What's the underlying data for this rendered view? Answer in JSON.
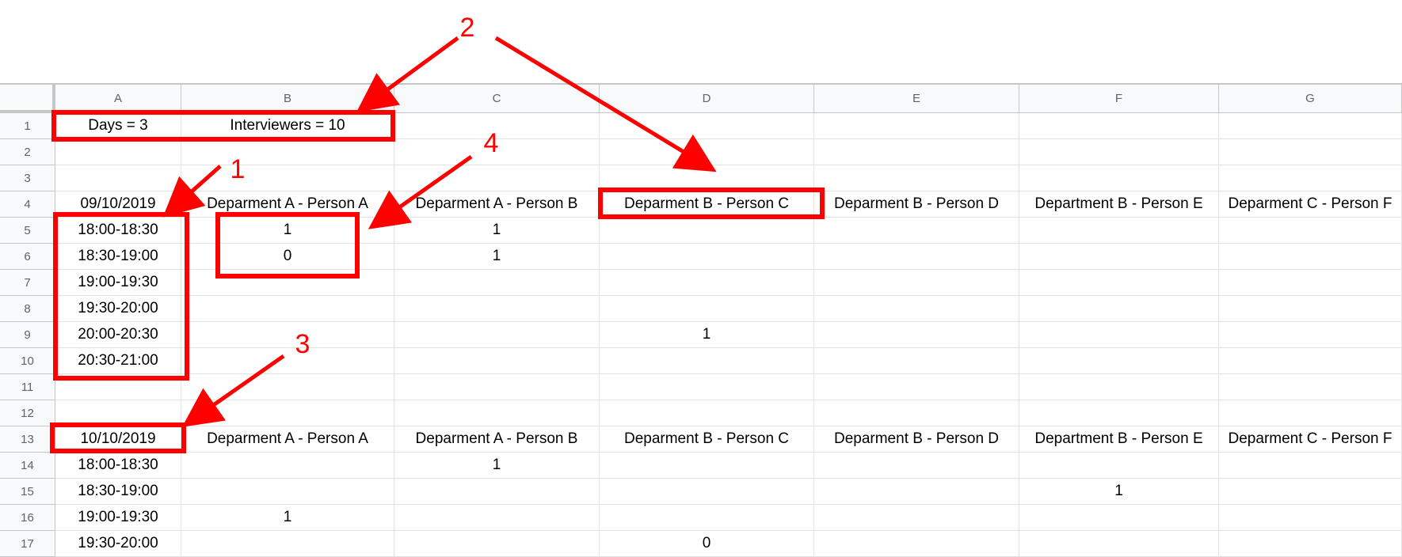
{
  "columns": [
    "A",
    "B",
    "C",
    "D",
    "E",
    "F",
    "G"
  ],
  "rows": [
    {
      "num": "1",
      "cells": [
        "Days = 3",
        "Interviewers = 10",
        "",
        "",
        "",
        "",
        ""
      ]
    },
    {
      "num": "2",
      "cells": [
        "",
        "",
        "",
        "",
        "",
        "",
        ""
      ]
    },
    {
      "num": "3",
      "cells": [
        "",
        "",
        "",
        "",
        "",
        "",
        ""
      ]
    },
    {
      "num": "4",
      "cells": [
        "09/10/2019",
        "Deparment A - Person A",
        "Deparment A - Person B",
        "Deparment B - Person C",
        "Deparment B - Person D",
        "Department B - Person E",
        "Deparment C - Person F"
      ]
    },
    {
      "num": "5",
      "cells": [
        "18:00-18:30",
        "1",
        "1",
        "",
        "",
        "",
        ""
      ]
    },
    {
      "num": "6",
      "cells": [
        "18:30-19:00",
        "0",
        "1",
        "",
        "",
        "",
        ""
      ]
    },
    {
      "num": "7",
      "cells": [
        "19:00-19:30",
        "",
        "",
        "",
        "",
        "",
        ""
      ]
    },
    {
      "num": "8",
      "cells": [
        "19:30-20:00",
        "",
        "",
        "",
        "",
        "",
        ""
      ]
    },
    {
      "num": "9",
      "cells": [
        "20:00-20:30",
        "",
        "",
        "1",
        "",
        "",
        ""
      ]
    },
    {
      "num": "10",
      "cells": [
        "20:30-21:00",
        "",
        "",
        "",
        "",
        "",
        ""
      ]
    },
    {
      "num": "11",
      "cells": [
        "",
        "",
        "",
        "",
        "",
        "",
        ""
      ]
    },
    {
      "num": "12",
      "cells": [
        "",
        "",
        "",
        "",
        "",
        "",
        ""
      ]
    },
    {
      "num": "13",
      "cells": [
        "10/10/2019",
        "Deparment A - Person A",
        "Deparment A - Person B",
        "Deparment B - Person C",
        "Deparment B - Person D",
        "Department B - Person E",
        "Deparment C - Person F"
      ]
    },
    {
      "num": "14",
      "cells": [
        "18:00-18:30",
        "",
        "1",
        "",
        "",
        "",
        ""
      ]
    },
    {
      "num": "15",
      "cells": [
        "18:30-19:00",
        "",
        "",
        "",
        "",
        "1",
        ""
      ]
    },
    {
      "num": "16",
      "cells": [
        "19:00-19:30",
        "1",
        "",
        "",
        "",
        "",
        ""
      ]
    },
    {
      "num": "17",
      "cells": [
        "19:30-20:00",
        "",
        "",
        "0",
        "",
        "",
        ""
      ]
    }
  ],
  "annotations": {
    "color": "#ff0000",
    "labels": [
      "1",
      "2",
      "3",
      "4"
    ]
  }
}
